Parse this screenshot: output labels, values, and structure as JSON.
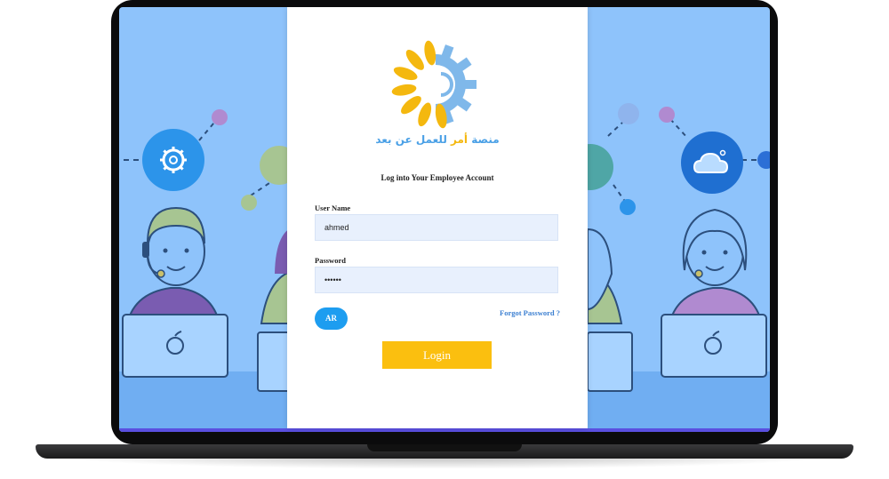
{
  "app": {
    "logo_icon": "sun-gear-logo",
    "logo_text_part1": "منصة",
    "logo_text_part2": "أمر",
    "logo_text_part3": "للعمل عن بعد",
    "colors": {
      "brand_blue": "#4aa0e6",
      "brand_yellow": "#f4b80f",
      "screen_bg": "#8ec3fb"
    }
  },
  "login": {
    "heading": "Log into Your Employee Account",
    "username_label": "User Name",
    "username_value": "ahmed",
    "password_label": "Password",
    "password_value": "••••••",
    "language_button": "AR",
    "forgot_link": "Forgot Password ?",
    "submit_label": "Login",
    "colors": {
      "input_bg": "#e8f0fd",
      "lang_btn": "#1d9df0",
      "submit_btn": "#fbbf0f",
      "link": "#3b7fd1"
    }
  }
}
